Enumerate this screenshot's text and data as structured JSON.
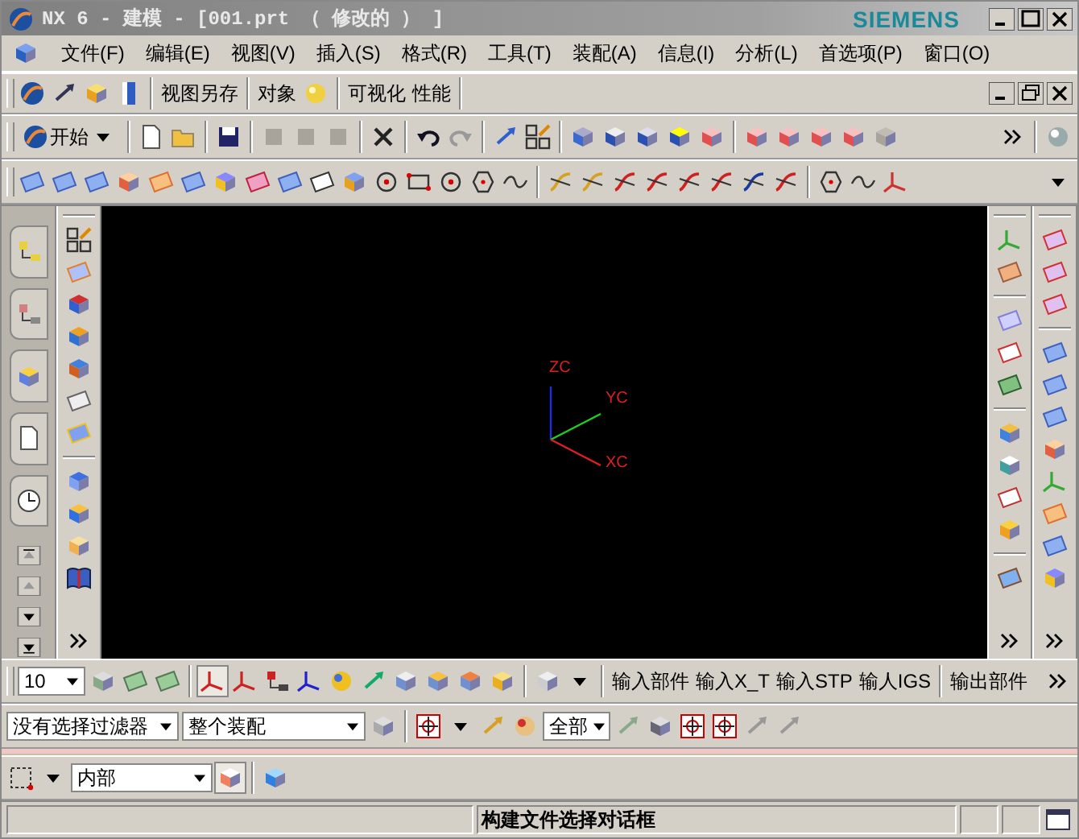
{
  "window": {
    "title": "NX 6 - 建模 - [001.prt （ 修改的 ） ]",
    "brand": "SIEMENS"
  },
  "menu": [
    {
      "label": "文件(F)"
    },
    {
      "label": "编辑(E)"
    },
    {
      "label": "视图(V)"
    },
    {
      "label": "插入(S)"
    },
    {
      "label": "格式(R)"
    },
    {
      "label": "工具(T)"
    },
    {
      "label": "装配(A)"
    },
    {
      "label": "信息(I)"
    },
    {
      "label": "分析(L)"
    },
    {
      "label": "首选项(P)"
    },
    {
      "label": "窗口(O)"
    }
  ],
  "view_toolbar": {
    "save_view": "视图另存",
    "object": "对象",
    "visualize": "可视化",
    "performance": "性能"
  },
  "standard_toolbar": {
    "start": "开始"
  },
  "canvas": {
    "axes": [
      {
        "label": "ZC"
      },
      {
        "label": "YC"
      },
      {
        "label": "XC"
      }
    ]
  },
  "assembly_toolbar": {
    "layer": "10",
    "buttons": [
      "输入部件",
      "输入X_T",
      "输入STP",
      "输人IGS",
      "输出部件"
    ]
  },
  "selection_bar": {
    "filter": "没有选择过滤器",
    "scope": "整个装配",
    "snap": "全部"
  },
  "selection_mode": {
    "value": "内部"
  },
  "status_bar": {
    "message": "构建文件选择对话框"
  }
}
